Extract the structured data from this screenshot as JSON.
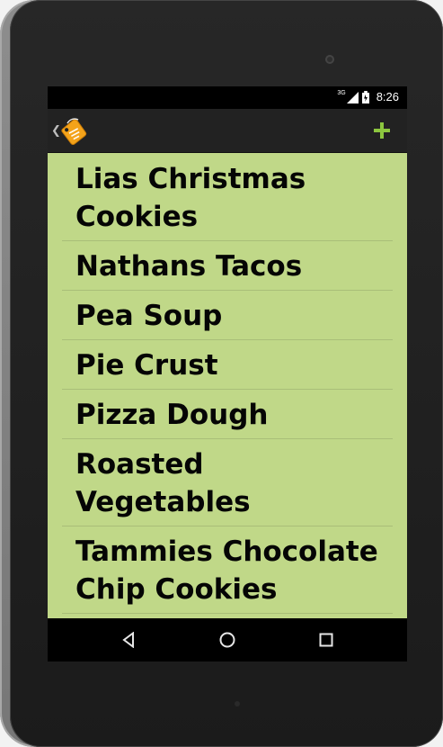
{
  "status_bar": {
    "network_type": "3G",
    "time": "8:26"
  },
  "action_bar": {
    "up_icon": "chevron-left-icon",
    "app_icon": "recipe-tag-icon",
    "add_action": "plus-icon",
    "accent_color": "#8cc63f"
  },
  "recipes": [
    "Lias Christmas Cookies",
    "Nathans Tacos",
    "Pea Soup",
    "Pie Crust",
    "Pizza Dough",
    "Roasted Vegetables",
    "Tammies Chocolate Chip Cookies"
  ],
  "navigation_bar": {
    "back_icon": "back-triangle-icon",
    "home_icon": "home-circle-icon",
    "recents_icon": "recents-square-icon"
  },
  "colors": {
    "list_background": "#c0d888",
    "action_bar_background": "#222222",
    "status_bar_background": "#000000"
  }
}
